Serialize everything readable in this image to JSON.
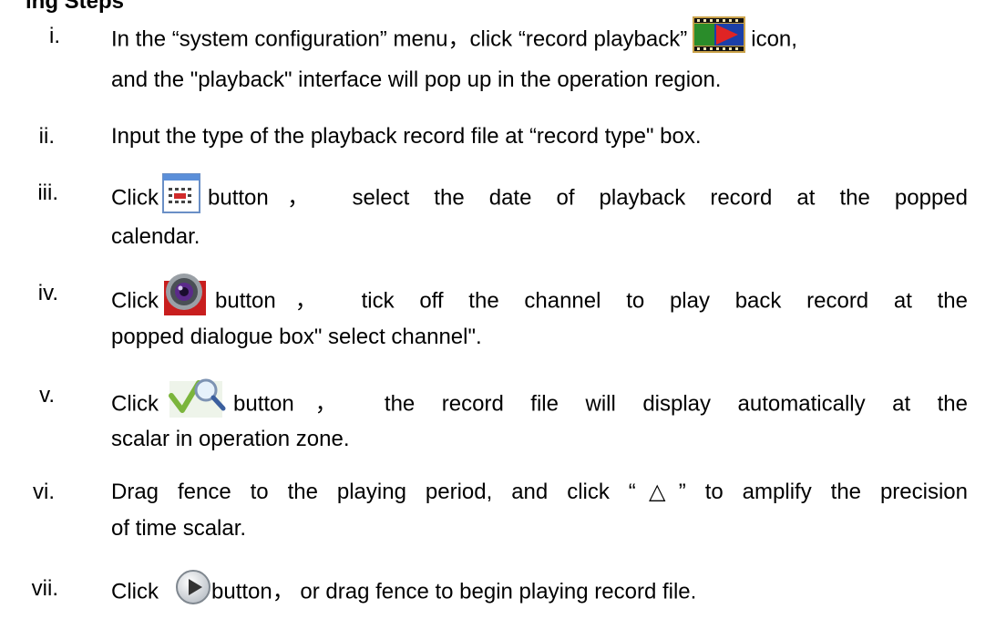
{
  "heading": "ing Steps",
  "steps": [
    {
      "num": "i.",
      "pre": "In the “system configuration” menu，click “record playback”",
      "post": "icon,",
      "line2": "and the \"playback\" interface will pop up in the operation region.",
      "icon": "record-playback-icon"
    },
    {
      "num": "ii.",
      "line1": "Input the type of the playback record file at “record type\" box."
    },
    {
      "num": "iii.",
      "pre": "Click",
      "post": "button， select the date of playback record at the popped",
      "line2": "calendar.",
      "icon": "calendar-icon"
    },
    {
      "num": "iv.",
      "pre": "Click",
      "post": "button， tick off the channel to play back record at the",
      "line2": "popped dialogue box\" select channel\".",
      "icon": "camera-icon"
    },
    {
      "num": "v.",
      "pre": "Click",
      "post": "button， the record file will display automatically at the",
      "line2": "scalar in operation zone.",
      "icon": "search-icon"
    },
    {
      "num": "vi.",
      "line1": "Drag fence to the playing period, and click “△” to amplify the precision",
      "line2": "of time scalar."
    },
    {
      "num": "vii.",
      "pre": "Click",
      "post": "button， or drag fence to begin playing record file.",
      "icon": "play-icon"
    }
  ],
  "colors": {
    "text": "#000000",
    "background": "#ffffff"
  }
}
